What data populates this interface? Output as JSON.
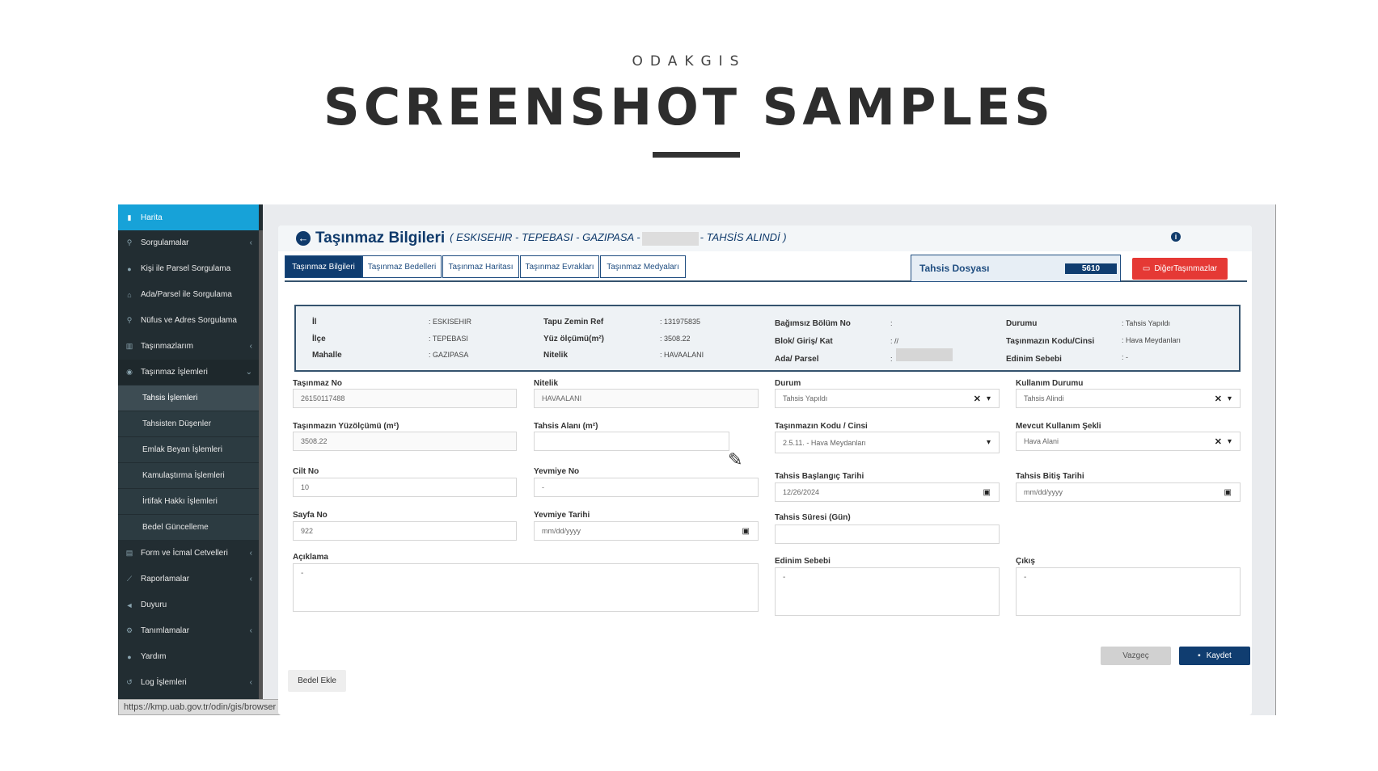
{
  "header": {
    "brand": "ODAKGIS",
    "headline": "SCREENSHOT SAMPLES"
  },
  "sidebar": {
    "items": [
      {
        "label": "Harita",
        "icon": "map-icon"
      },
      {
        "label": "Sorgulamalar",
        "icon": "search-icon"
      },
      {
        "label": "Kişi ile Parsel Sorgulama",
        "icon": "user-icon"
      },
      {
        "label": "Ada/Parsel ile Sorgulama",
        "icon": "home-icon"
      },
      {
        "label": "Nüfus ve Adres Sorgulama",
        "icon": "search-icon"
      },
      {
        "label": "Taşınmazlarım",
        "icon": "building-icon"
      },
      {
        "label": "Taşınmaz İşlemleri",
        "icon": "eye-icon"
      },
      {
        "label": "Tahsis İşlemleri"
      },
      {
        "label": "Tahsisten Düşenler"
      },
      {
        "label": "Emlak Beyan İşlemleri"
      },
      {
        "label": "Kamulaştırma İşlemleri"
      },
      {
        "label": "İrtifak Hakkı İşlemleri"
      },
      {
        "label": "Bedel Güncelleme"
      },
      {
        "label": "Form ve İcmal Cetvelleri",
        "icon": "form-icon"
      },
      {
        "label": "Raporlamalar",
        "icon": "chart-icon"
      },
      {
        "label": "Duyuru",
        "icon": "megaphone-icon"
      },
      {
        "label": "Tanımlamalar",
        "icon": "gears-icon"
      },
      {
        "label": "Yardım",
        "icon": "help-icon"
      },
      {
        "label": "Log İşlemleri",
        "icon": "history-icon"
      }
    ],
    "status_url": "https://kmp.uab.gov.tr/odin/gis/browser"
  },
  "panel": {
    "title": "Taşınmaz Bilgileri",
    "subtitle_a": "( ESKISEHIR - TEPEBASI - GAZIPASA -",
    "subtitle_b": "- TAHSİS ALINDİ )"
  },
  "tabs": [
    "Taşınmaz Bilgileri",
    "Taşınmaz Bedelleri",
    "Taşınmaz Haritası",
    "Taşınmaz Evrakları",
    "Taşınmaz Medyaları"
  ],
  "tahsis": {
    "label": "Tahsis Dosyası",
    "value": "5610"
  },
  "other_button": "DiğerTaşınmazlar",
  "summary": {
    "il_label": "İl",
    "il_value": ": ESKISEHIR",
    "ilce_label": "İlçe",
    "ilce_value": ": TEPEBASI",
    "mahalle_label": "Mahalle",
    "mahalle_value": ": GAZIPASA",
    "tapu_label": "Tapu Zemin Ref",
    "tapu_value": ": 131975835",
    "yuz_label": "Yüz ölçümü(m²)",
    "yuz_value": ": 3508.22",
    "nitelik_label": "Nitelik",
    "nitelik_value": ": HAVAALANI",
    "bagimsiz_label": "Bağımsız Bölüm No",
    "bagimsiz_value": ":",
    "blok_label": "Blok/ Giriş/ Kat",
    "blok_value": ": //",
    "ada_label": "Ada/ Parsel",
    "ada_value": ":",
    "durumu_label": "Durumu",
    "durumu_value": ": Tahsis Yapıldı",
    "kodu_label": "Taşınmazın Kodu/Cinsi",
    "kodu_value": ": Hava Meydanları",
    "edinim_label": "Edinim Sebebi",
    "edinim_value": ": -"
  },
  "form": {
    "tasinmaz_no_label": "Taşınmaz No",
    "tasinmaz_no": "26150117488",
    "nitelik_label": "Nitelik",
    "nitelik": "HAVAALANI",
    "durum_label": "Durum",
    "durum": "Tahsis Yapıldı",
    "kullanim_label": "Kullanım Durumu",
    "kullanim": "Tahsis Alindi",
    "yuzolcum_label": "Taşınmazın Yüzölçümü (m²)",
    "yuzolcum": "3508.22",
    "tahsis_alani_label": "Tahsis Alanı (m²)",
    "tahsis_alani": "",
    "kodu_cinsi_label": "Taşınmazın Kodu / Cinsi",
    "kodu_cinsi": "2.5.11. - Hava Meydanları",
    "mevcut_label": "Mevcut Kullanım Şekli",
    "mevcut": "Hava Alani",
    "cilt_label": "Cilt No",
    "cilt": "10",
    "yevmiye_no_label": "Yevmiye No",
    "yevmiye_no": "-",
    "baslangic_label": "Tahsis Başlangıç Tarihi",
    "baslangic": "12/26/2024",
    "bitis_label": "Tahsis Bitiş Tarihi",
    "bitis": "mm/dd/yyyy",
    "sayfa_label": "Sayfa No",
    "sayfa": "922",
    "yevmiye_tarihi_label": "Yevmiye Tarihi",
    "yevmiye_tarihi": "mm/dd/yyyy",
    "sure_label": "Tahsis Süresi (Gün)",
    "sure": "",
    "aciklama_label": "Açıklama",
    "aciklama": "-",
    "edinim_label": "Edinim Sebebi",
    "edinim": "-",
    "cikis_label": "Çıkış",
    "cikis": "-"
  },
  "buttons": {
    "cancel": "Vazgeç",
    "save": "Kaydet",
    "add_bedel": "Bedel Ekle"
  }
}
